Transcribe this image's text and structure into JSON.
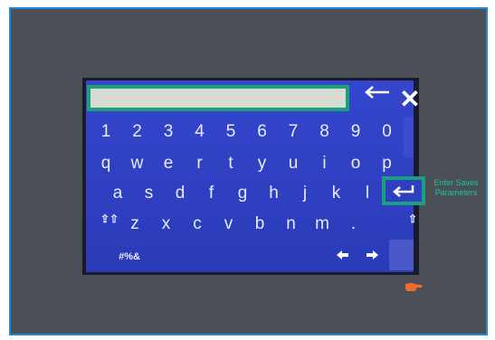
{
  "keyboard": {
    "row_numbers": [
      "1",
      "2",
      "3",
      "4",
      "5",
      "6",
      "7",
      "8",
      "9",
      "0"
    ],
    "row_top": [
      "q",
      "w",
      "e",
      "r",
      "t",
      "y",
      "u",
      "i",
      "o",
      "p"
    ],
    "row_home": [
      "a",
      "s",
      "d",
      "f",
      "g",
      "h",
      "j",
      "k",
      "l"
    ],
    "row_bottom": [
      "z",
      "x",
      "c",
      "v",
      "b",
      "n",
      "m",
      "."
    ],
    "caps_lock_label": "⇪⇧",
    "shift_label": "⇧",
    "symbols_label": "#%&",
    "arrow_left_label": "◆",
    "arrow_right_label": "➜"
  },
  "annotations": {
    "enter_note": "Enter Saves Parameters"
  },
  "colors": {
    "keyboard_bg": "#2e3fc1",
    "highlight": "#1aa07d",
    "note_text": "#19c49a"
  }
}
